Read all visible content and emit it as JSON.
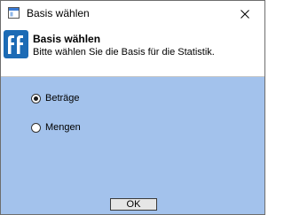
{
  "window": {
    "title": "Basis wählen"
  },
  "header": {
    "title": "Basis wählen",
    "subtitle": "Bitte wählen Sie die Basis für die Statistik.",
    "logo_color": "#1c6bb5"
  },
  "options": [
    {
      "label": "Beträge",
      "selected": true
    },
    {
      "label": "Mengen",
      "selected": false
    }
  ],
  "buttons": {
    "ok_label": "OK"
  },
  "colors": {
    "content_bg": "#a3c2ec"
  }
}
